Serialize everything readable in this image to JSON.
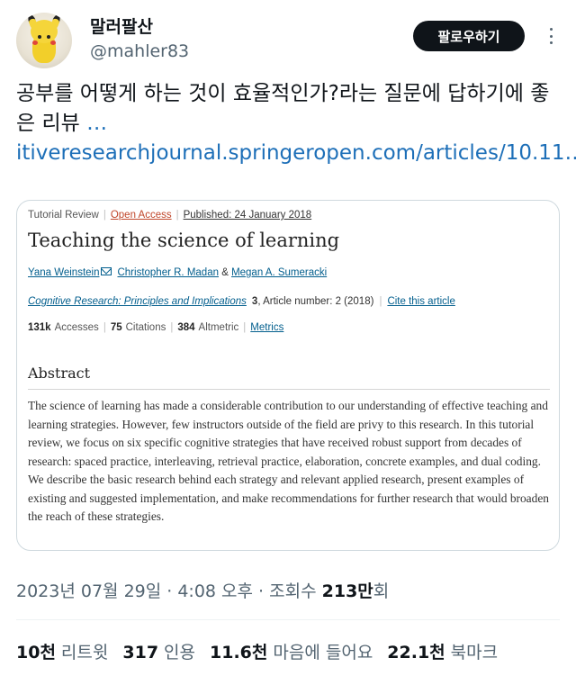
{
  "user": {
    "display_name": "말러팔산",
    "handle": "@mahler83"
  },
  "follow_button": "팔로우하기",
  "tweet": {
    "text": "공부를 어떻게 하는 것이 효율적인가?라는 질문에 답하기에 좋은 리뷰 ",
    "link": "…itiveresearchjournal.springeropen.com/articles/10.11…"
  },
  "card": {
    "type": "Tutorial Review",
    "access": "Open Access",
    "published": "Published: 24 January 2018",
    "title": "Teaching the science of learning",
    "authors": {
      "a1": "Yana Weinstein",
      "a2": "Christopher R. Madan",
      "amp": "&",
      "a3": "Megan A. Sumeracki"
    },
    "journal": {
      "name": "Cognitive Research: Principles and Implications",
      "volume": "3",
      "article": ", Article number: 2 (2018)",
      "cite": "Cite this article"
    },
    "metrics": {
      "accesses_value": "131k",
      "accesses_label": "Accesses",
      "citations_value": "75",
      "citations_label": "Citations",
      "altmetric_value": "384",
      "altmetric_label": "Altmetric",
      "metrics_link": "Metrics"
    },
    "abstract_heading": "Abstract",
    "abstract": "The science of learning has made a considerable contribution to our understanding of effective teaching and learning strategies. However, few instructors outside of the field are privy to this research. In this tutorial review, we focus on six specific cognitive strategies that have received robust support from decades of research: spaced practice, interleaving, retrieval practice, elaboration, concrete examples, and dual coding. We describe the basic research behind each strategy and relevant applied research, present examples of existing and suggested implementation, and make recommendations for further research that would broaden the reach of these strategies."
  },
  "timestamp": {
    "date": "2023년 07월 29일 · 4:08 오후 · 조회수 ",
    "views": "213만",
    "views_suffix": "회"
  },
  "stats": {
    "retweets_value": "10천",
    "retweets_label": "리트윗",
    "quotes_value": "317",
    "quotes_label": "인용",
    "likes_value": "11.6천",
    "likes_label": "마음에 들어요",
    "bookmarks_value": "22.1천",
    "bookmarks_label": "북마크"
  },
  "icons": {
    "avatar": "pikachu-plush-avatar",
    "more": "more-vertical-icon",
    "mail": "mail-icon"
  },
  "colors": {
    "link": "#1d6fb8",
    "follow_bg": "#0f1419",
    "open_access": "#c0462a",
    "journal_link": "#025e8d"
  }
}
